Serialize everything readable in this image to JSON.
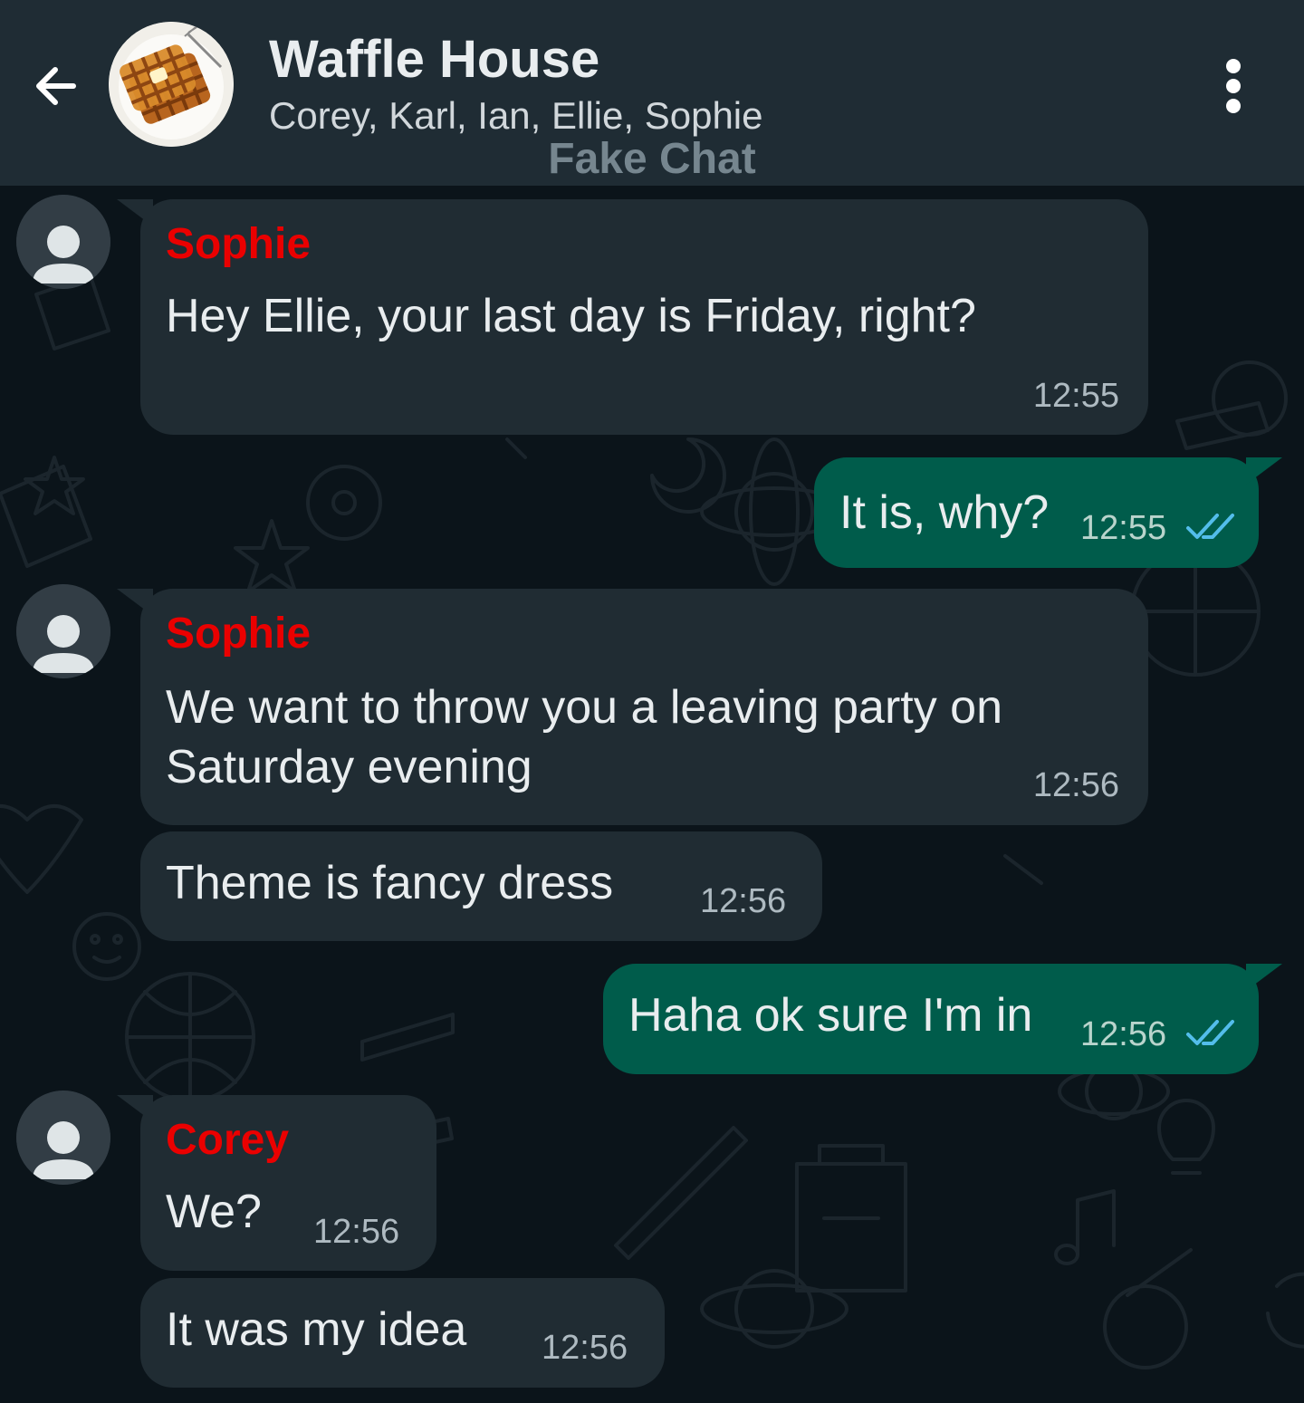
{
  "header": {
    "title": "Waffle House",
    "members": "Corey, Karl, Ian, Ellie, Sophie",
    "watermark": "Fake Chat"
  },
  "icons": {
    "back": "arrow-back-icon",
    "menu": "more-vertical-icon",
    "avatar": "person-icon",
    "read_receipt": "double-check-icon"
  },
  "colors": {
    "header_bg": "#1f2c34",
    "chat_bg": "#0b141a",
    "incoming_bubble": "#202c33",
    "outgoing_bubble": "#005c4b",
    "sender_name": "#ea0000",
    "read_tick": "#53bdeb"
  },
  "messages": [
    {
      "sender": "Sophie",
      "text": "Hey Ellie, your last day is Friday, right?",
      "time": "12:55"
    },
    {
      "text": "It is, why?",
      "time": "12:55"
    },
    {
      "sender": "Sophie",
      "text_line1": "We want to throw you a leaving party on",
      "text_line2": "Saturday evening",
      "time": "12:56"
    },
    {
      "text": "Theme is fancy dress",
      "time": "12:56"
    },
    {
      "text": "Haha ok sure I'm in",
      "time": "12:56"
    },
    {
      "sender": "Corey",
      "text": "We?",
      "time": "12:56"
    },
    {
      "text": "It was my idea",
      "time": "12:56"
    }
  ]
}
